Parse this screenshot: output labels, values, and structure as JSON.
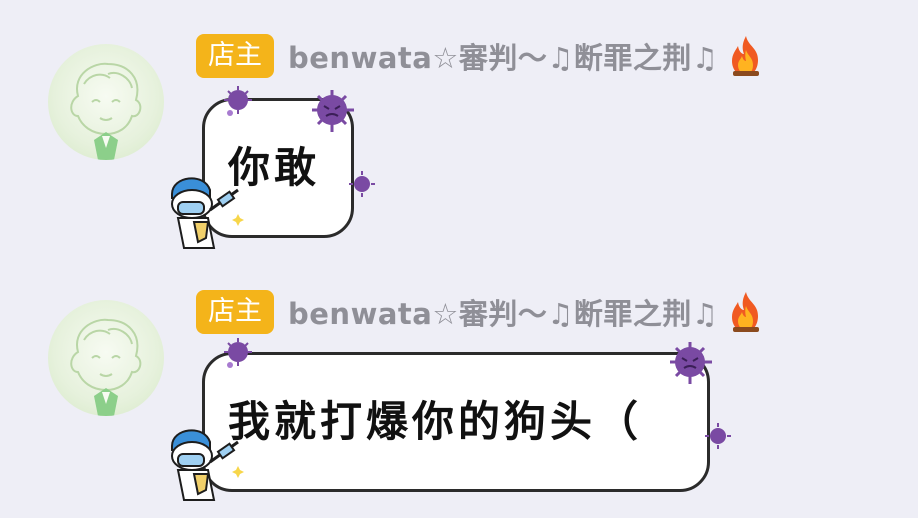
{
  "chat": {
    "messages": [
      {
        "badge": "店主",
        "sender": "benwata☆審判～♫断罪之荆♫",
        "sender_icon": "fire-icon",
        "text": "你敢"
      },
      {
        "badge": "店主",
        "sender": "benwata☆審判～♫断罪之荆♫",
        "sender_icon": "fire-icon",
        "text": "我就打爆你的狗头（"
      }
    ]
  },
  "colors": {
    "background": "#eeeef6",
    "badge": "#f4b41a",
    "sender": "#8f8f97",
    "bubble_border": "#2b2b2b",
    "virus": "#7a4aa3"
  }
}
